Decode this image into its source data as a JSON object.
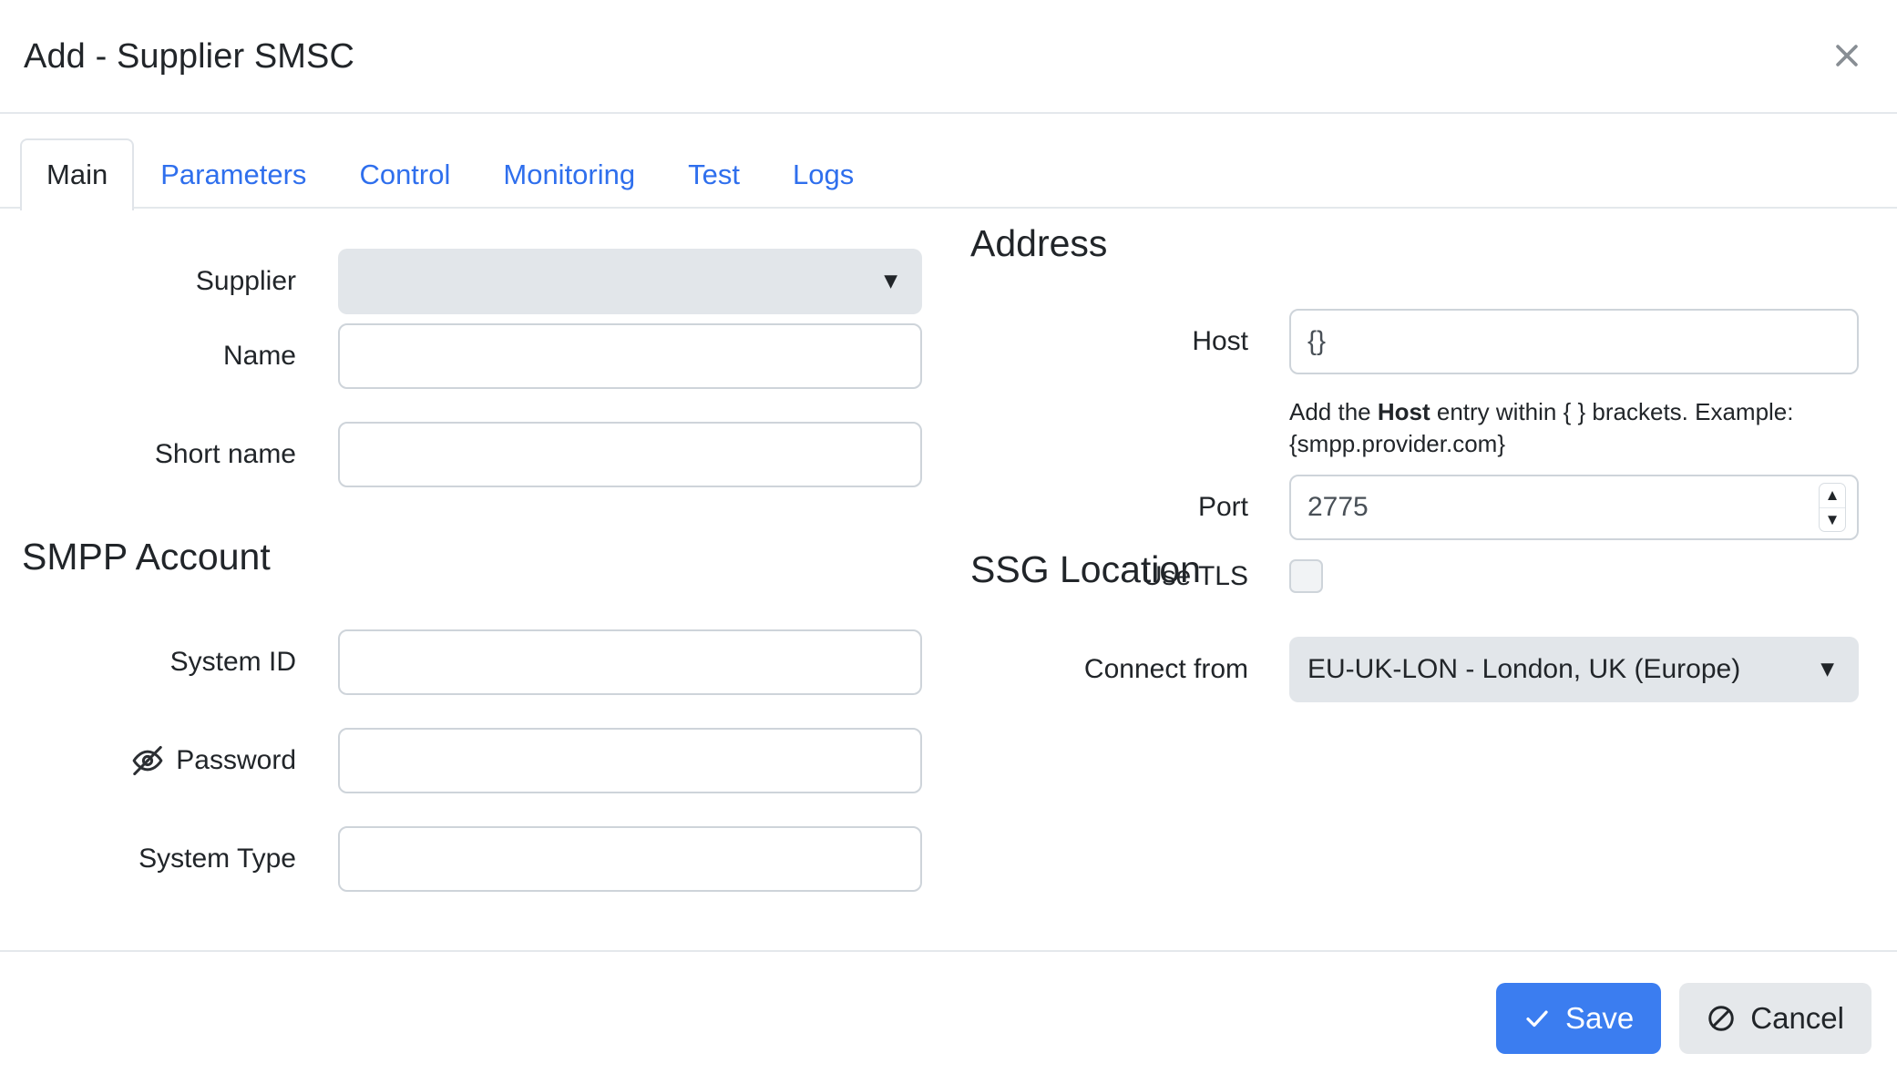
{
  "dialog": {
    "title": "Add - Supplier SMSC",
    "close_icon": "close-icon"
  },
  "tabs": [
    {
      "label": "Main",
      "active": true
    },
    {
      "label": "Parameters",
      "active": false
    },
    {
      "label": "Control",
      "active": false
    },
    {
      "label": "Monitoring",
      "active": false
    },
    {
      "label": "Test",
      "active": false
    },
    {
      "label": "Logs",
      "active": false
    }
  ],
  "left": {
    "supplier": {
      "label": "Supplier",
      "value": "",
      "icon": "chevron-down-icon"
    },
    "name": {
      "label": "Name",
      "value": "",
      "placeholder": ""
    },
    "short_name": {
      "label": "Short name",
      "value": "",
      "placeholder": ""
    },
    "smpp_account": {
      "heading": "SMPP Account",
      "system_id": {
        "label": "System ID",
        "value": "",
        "placeholder": ""
      },
      "password": {
        "label": "Password",
        "value": "",
        "placeholder": "",
        "icon": "eye-off-icon"
      },
      "system_type": {
        "label": "System Type",
        "value": "",
        "placeholder": ""
      }
    }
  },
  "right": {
    "address": {
      "heading": "Address",
      "host": {
        "label": "Host",
        "value": "{}",
        "placeholder": ""
      },
      "host_hint_prefix": "Add the ",
      "host_hint_bold": "Host",
      "host_hint_suffix": " entry within { } brackets. Example: {smpp.provider.com}",
      "port": {
        "label": "Port",
        "value": "2775"
      },
      "use_tls": {
        "label": "Use TLS",
        "checked": false
      }
    },
    "ssg_location": {
      "heading": "SSG Location",
      "connect_from": {
        "label": "Connect from",
        "value": "EU-UK-LON - London, UK (Europe)",
        "icon": "chevron-down-icon"
      }
    }
  },
  "footer": {
    "save_label": "Save",
    "cancel_label": "Cancel",
    "save_icon": "check-icon",
    "cancel_icon": "ban-icon"
  },
  "colors": {
    "accent": "#3b7df0",
    "tab_link": "#2f6fed",
    "input_border": "#ced4da",
    "select_bg": "#e2e6ea",
    "divider": "#e4e8ec",
    "text": "#212529"
  }
}
